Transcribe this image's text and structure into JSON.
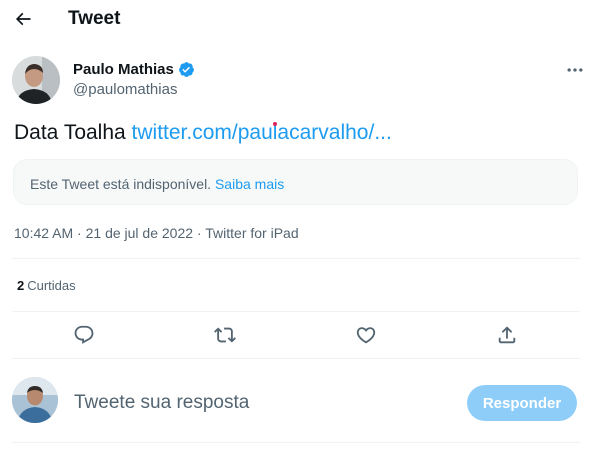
{
  "header": {
    "title": "Tweet",
    "back_icon": "arrow-left-icon"
  },
  "author": {
    "name": "Paulo Mathias",
    "handle": "@paulomathias",
    "verified_icon": "verified-badge-icon",
    "more_icon": "more-horizontal-icon"
  },
  "tweet": {
    "text": "Data Toalha ",
    "link_text": "twitter.com/paulacarvalho/..."
  },
  "unavailable": {
    "text": "Este Tweet está indisponível. ",
    "learn_more": "Saiba mais"
  },
  "meta": {
    "time": "10:42 AM",
    "separator": " · ",
    "date": "21 de jul de 2022",
    "source": "Twitter for iPad"
  },
  "stats": {
    "likes_count": "2",
    "likes_label": "Curtidas"
  },
  "actions": {
    "reply_icon": "reply-icon",
    "retweet_icon": "retweet-icon",
    "like_icon": "like-icon",
    "share_icon": "share-icon"
  },
  "reply": {
    "placeholder": "Tweete sua resposta",
    "button_label": "Responder"
  },
  "colors": {
    "accent": "#1d9bf0",
    "text": "#0f1419",
    "secondary": "#536471",
    "button_disabled": "#8ecdf8"
  }
}
